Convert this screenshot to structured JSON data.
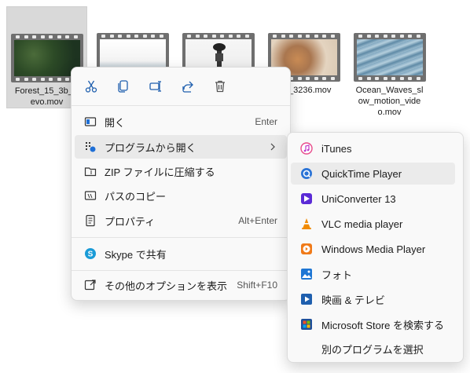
{
  "files": [
    {
      "name": "Forest_15_3b_V…evo.mov",
      "name_line1": "Forest_15_3b_V",
      "name_line2": "evo.mov",
      "selected": true
    },
    {
      "name": "",
      "name_line1": "",
      "name_line2": ""
    },
    {
      "name": "",
      "name_line1": "",
      "name_line2": ""
    },
    {
      "name": "_3236.mov",
      "name_line1": "_3236.mov",
      "name_line2": ""
    },
    {
      "name": "Ocean_Waves_slow_motion_video.mov",
      "name_line1": "Ocean_Waves_sl",
      "name_line2": "ow_motion_vide",
      "name_line3": "o.mov"
    }
  ],
  "context_menu": {
    "toolbar_icons": [
      "cut-icon",
      "copy-icon",
      "rename-icon",
      "share-icon",
      "delete-icon"
    ],
    "items": [
      {
        "label": "開く",
        "shortcut": "Enter",
        "icon": "open-icon"
      },
      {
        "label": "プログラムから開く",
        "shortcut": "",
        "icon": "open-with-icon",
        "has_submenu": true
      },
      {
        "label": "ZIP ファイルに圧縮する",
        "shortcut": "",
        "icon": "zip-icon"
      },
      {
        "label": "パスのコピー",
        "shortcut": "",
        "icon": "copy-path-icon"
      },
      {
        "label": "プロパティ",
        "shortcut": "Alt+Enter",
        "icon": "properties-icon"
      },
      {
        "label": "Skype で共有",
        "shortcut": "",
        "icon": "skype-icon"
      },
      {
        "label": "その他のオプションを表示",
        "shortcut": "Shift+F10",
        "icon": "more-options-icon"
      }
    ]
  },
  "submenu": {
    "items": [
      {
        "label": "iTunes",
        "icon": "itunes-icon"
      },
      {
        "label": "QuickTime Player",
        "icon": "quicktime-icon",
        "highlighted": true
      },
      {
        "label": "UniConverter 13",
        "icon": "uniconverter-icon"
      },
      {
        "label": "VLC media player",
        "icon": "vlc-icon"
      },
      {
        "label": "Windows Media Player",
        "icon": "wmp-icon"
      },
      {
        "label": "フォト",
        "icon": "photos-icon"
      },
      {
        "label": "映画 & テレビ",
        "icon": "movies-tv-icon"
      },
      {
        "label": "Microsoft Store を検索する",
        "icon": "store-icon"
      },
      {
        "label": "別のプログラムを選択",
        "icon": ""
      }
    ]
  }
}
